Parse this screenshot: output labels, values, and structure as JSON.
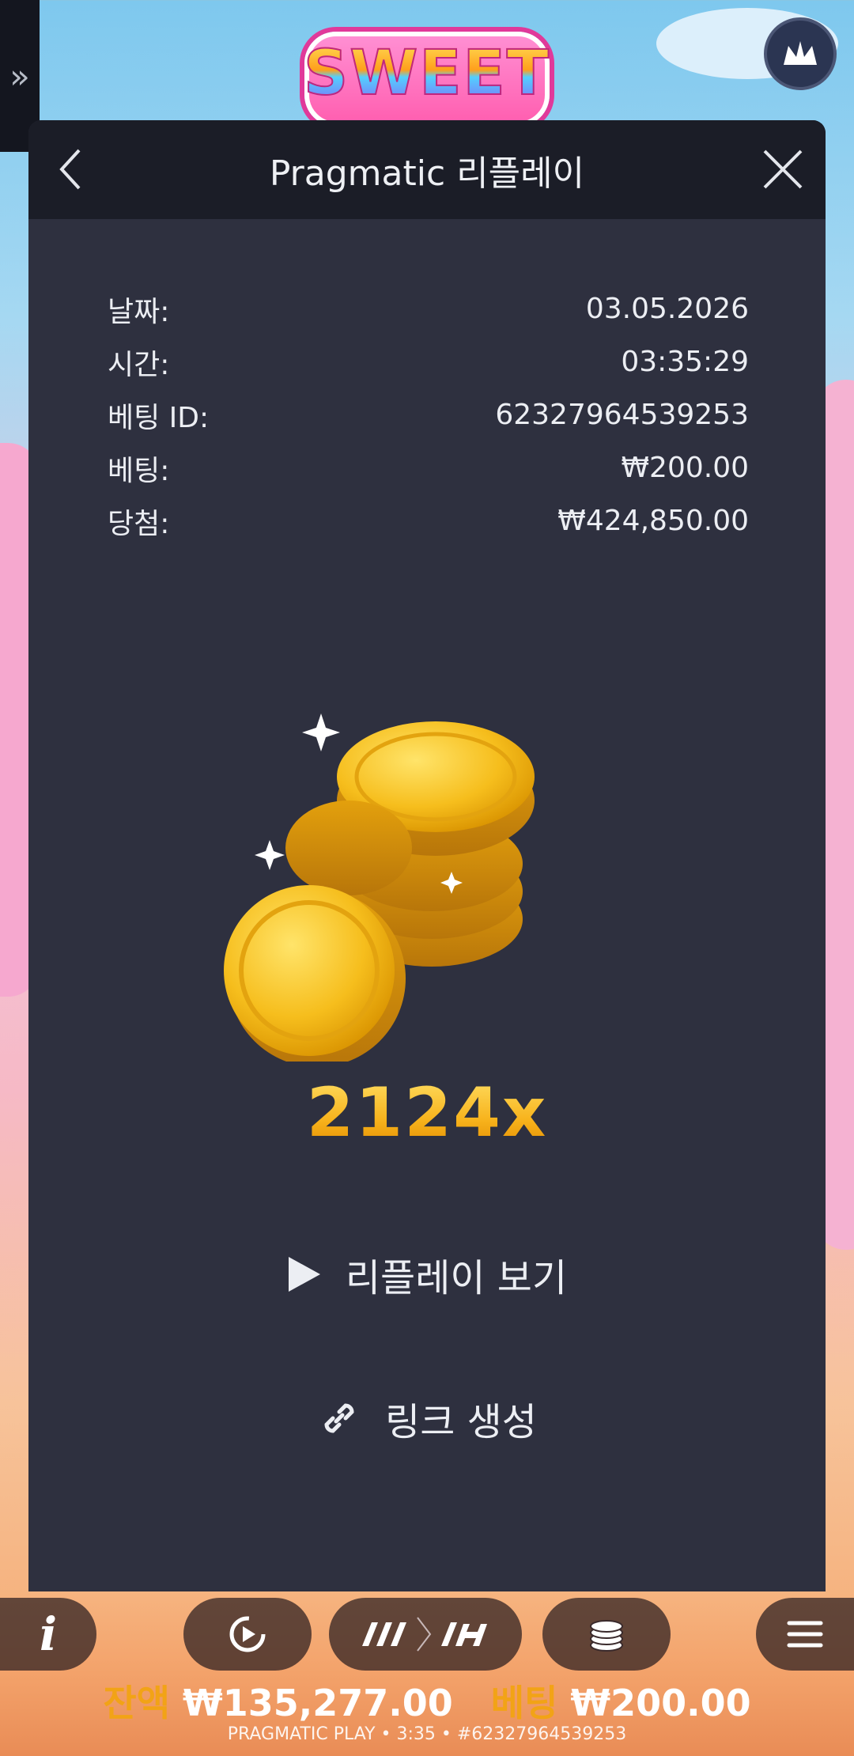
{
  "game": {
    "logo_text": "SWEET"
  },
  "modal": {
    "title": "Pragmatic 리플레이",
    "rows": [
      {
        "label": "날짜:",
        "value": "03.05.2026"
      },
      {
        "label": "시간:",
        "value": "03:35:29"
      },
      {
        "label": "베팅 ID:",
        "value": "62327964539253"
      },
      {
        "label": "베팅:",
        "value": "₩200.00"
      },
      {
        "label": "당첨:",
        "value": "₩424,850.00"
      }
    ],
    "multiplier": "2124x",
    "replay_label": "리플레이 보기",
    "link_label": "링크 생성"
  },
  "bottom": {
    "info_icon_text": "i",
    "balance_label": "잔액",
    "balance_value": "₩135,277.00",
    "bet_label": "베팅",
    "bet_value": "₩200.00",
    "footer": "PRAGMATIC PLAY • 3:35 • #62327964539253"
  },
  "icons": {
    "expand": "double-chevron-right-icon",
    "crown": "crown-icon",
    "back": "chevron-left-icon",
    "close": "close-icon",
    "play": "play-icon",
    "link": "link-icon",
    "autoplay": "autoplay-icon",
    "speed": "turbo-spin-icon",
    "bet": "coin-stack-icon",
    "menu": "hamburger-menu-icon"
  },
  "colors": {
    "modal_bg": "#2e303f",
    "header_bg": "#1b1d27",
    "multiplier_gold": "#f7b21b",
    "balance_label": "#f2a316"
  }
}
